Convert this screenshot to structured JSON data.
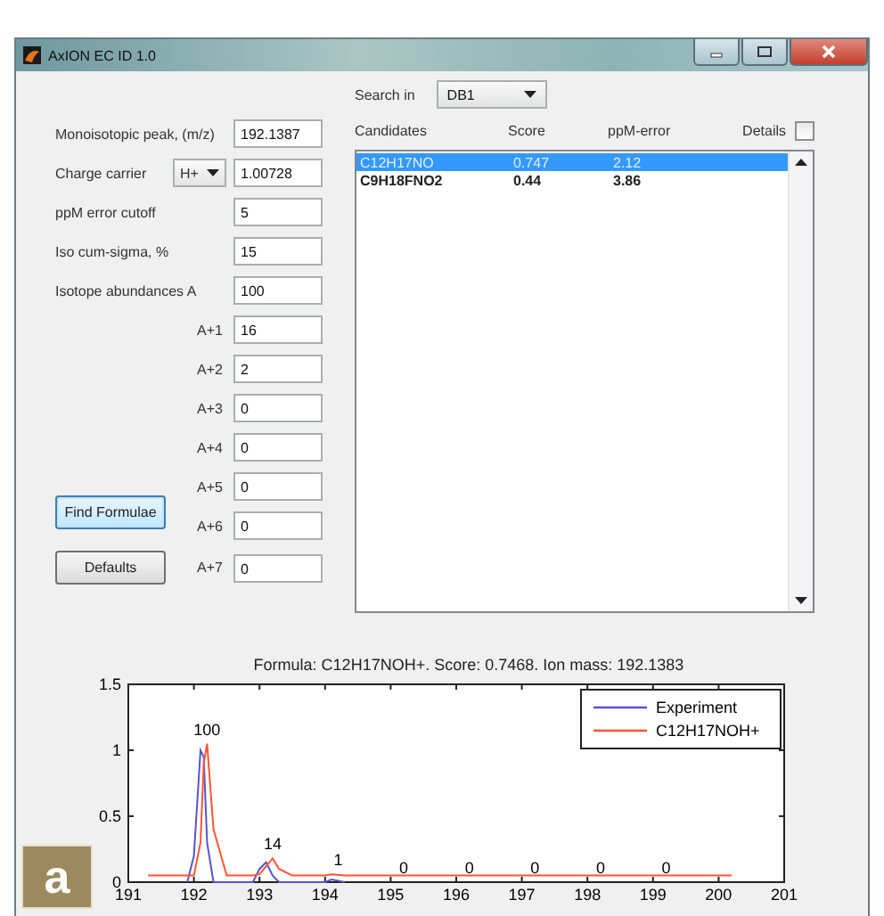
{
  "window": {
    "title": "AxION EC ID 1.0"
  },
  "form": {
    "fields": [
      {
        "kind": "field",
        "label": "Monoisotopic peak, (m/z)",
        "value": "192.1387"
      },
      {
        "kind": "carrier",
        "label": "Charge carrier",
        "select": "H+",
        "value": "1.00728"
      },
      {
        "kind": "field",
        "label": "ppM error cutoff",
        "value": "5"
      },
      {
        "kind": "field",
        "label": "Iso cum-sigma, %",
        "value": "15"
      },
      {
        "kind": "field",
        "label": "Isotope abundances A",
        "value": "100"
      },
      {
        "kind": "isotope",
        "label": "A+1",
        "value": "16"
      },
      {
        "kind": "isotope",
        "label": "A+2",
        "value": "2"
      },
      {
        "kind": "isotope",
        "label": "A+3",
        "value": "0"
      },
      {
        "kind": "isotope",
        "label": "A+4",
        "value": "0"
      },
      {
        "kind": "isotope",
        "label": "A+5",
        "value": "0"
      },
      {
        "kind": "isotope",
        "label": "A+6",
        "value": "0"
      },
      {
        "kind": "isotope",
        "label": "A+7",
        "value": "0"
      }
    ],
    "buttons": [
      {
        "label": "Find Formulae",
        "focused": true
      },
      {
        "label": "Defaults",
        "focused": false
      }
    ]
  },
  "search": {
    "label": "Search in",
    "value": "DB1"
  },
  "candidates": {
    "columns": [
      "Candidates",
      "Score",
      "ppM-error"
    ],
    "details": {
      "label": "Details",
      "checked": false
    },
    "rows": [
      {
        "cells": [
          "C12H17NO",
          "0.747",
          "2.12"
        ],
        "selected": true
      },
      {
        "cells": [
          "C9H18FNO2",
          "0.44",
          "3.86"
        ],
        "selected": false
      }
    ]
  },
  "chart": {
    "chart_data": {
      "type": "line",
      "title": "Formula: C12H17NOH+. Score: 0.7468. Ion mass: 192.1383",
      "x": [
        191.3,
        191.9,
        192.0,
        192.1,
        192.15,
        192.2,
        192.3,
        192.5,
        192.9,
        193.0,
        193.1,
        193.2,
        193.3,
        193.5,
        194.0,
        194.1,
        194.3,
        200.2
      ],
      "series": [
        {
          "name": "Experiment",
          "color": "#5555cc",
          "values": [
            null,
            0,
            0.2,
            1.0,
            0.95,
            0.3,
            0,
            0,
            0,
            0.1,
            0.15,
            0.05,
            0,
            0,
            0,
            0.02,
            0,
            null
          ]
        },
        {
          "name": "C12H17NOH+",
          "color": "#ff5533",
          "values": [
            0.05,
            0.05,
            0.05,
            0.3,
            0.9,
            1.05,
            0.4,
            0.05,
            0.05,
            0.06,
            0.12,
            0.18,
            0.1,
            0.05,
            0.05,
            0.06,
            0.05,
            0.05
          ]
        }
      ],
      "xlim": [
        191,
        201
      ],
      "ylim": [
        0,
        1.5
      ],
      "xticks": [
        191,
        192,
        193,
        194,
        195,
        196,
        197,
        198,
        199,
        200,
        201
      ],
      "yticks": [
        {
          "value": 0,
          "label": "0"
        },
        {
          "value": 0.5,
          "label": "0.5"
        },
        {
          "value": 1,
          "label": "1"
        },
        {
          "value": 1.5,
          "label": "1.5"
        }
      ],
      "legend": true,
      "annotations": [
        "100",
        "14",
        "1",
        "0",
        "0",
        "0",
        "0",
        "0"
      ]
    }
  },
  "panel_label": "a"
}
